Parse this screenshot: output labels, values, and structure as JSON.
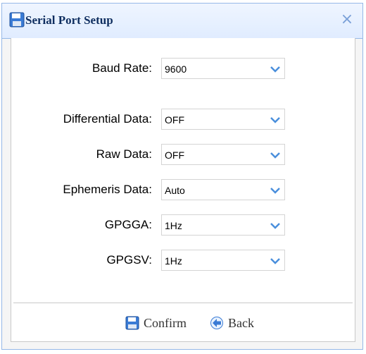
{
  "dialog": {
    "title": "Serial Port Setup",
    "close_icon": "close-icon",
    "title_icon": "floppy-disk-icon"
  },
  "fields": [
    {
      "label": "Baud Rate:",
      "value": "9600"
    },
    {
      "label": "Differential Data:",
      "value": "OFF"
    },
    {
      "label": "Raw Data:",
      "value": "OFF"
    },
    {
      "label": "Ephemeris Data:",
      "value": "Auto"
    },
    {
      "label": "GPGGA:",
      "value": "1Hz"
    },
    {
      "label": "GPGSV:",
      "value": "1Hz"
    }
  ],
  "buttons": {
    "confirm_label": "Confirm",
    "back_label": "Back",
    "confirm_icon": "floppy-disk-icon",
    "back_icon": "back-arrow-icon"
  },
  "colors": {
    "title_border": "#95b8e7",
    "title_text": "#0e2d5f",
    "accent": "#4a8fdc"
  }
}
